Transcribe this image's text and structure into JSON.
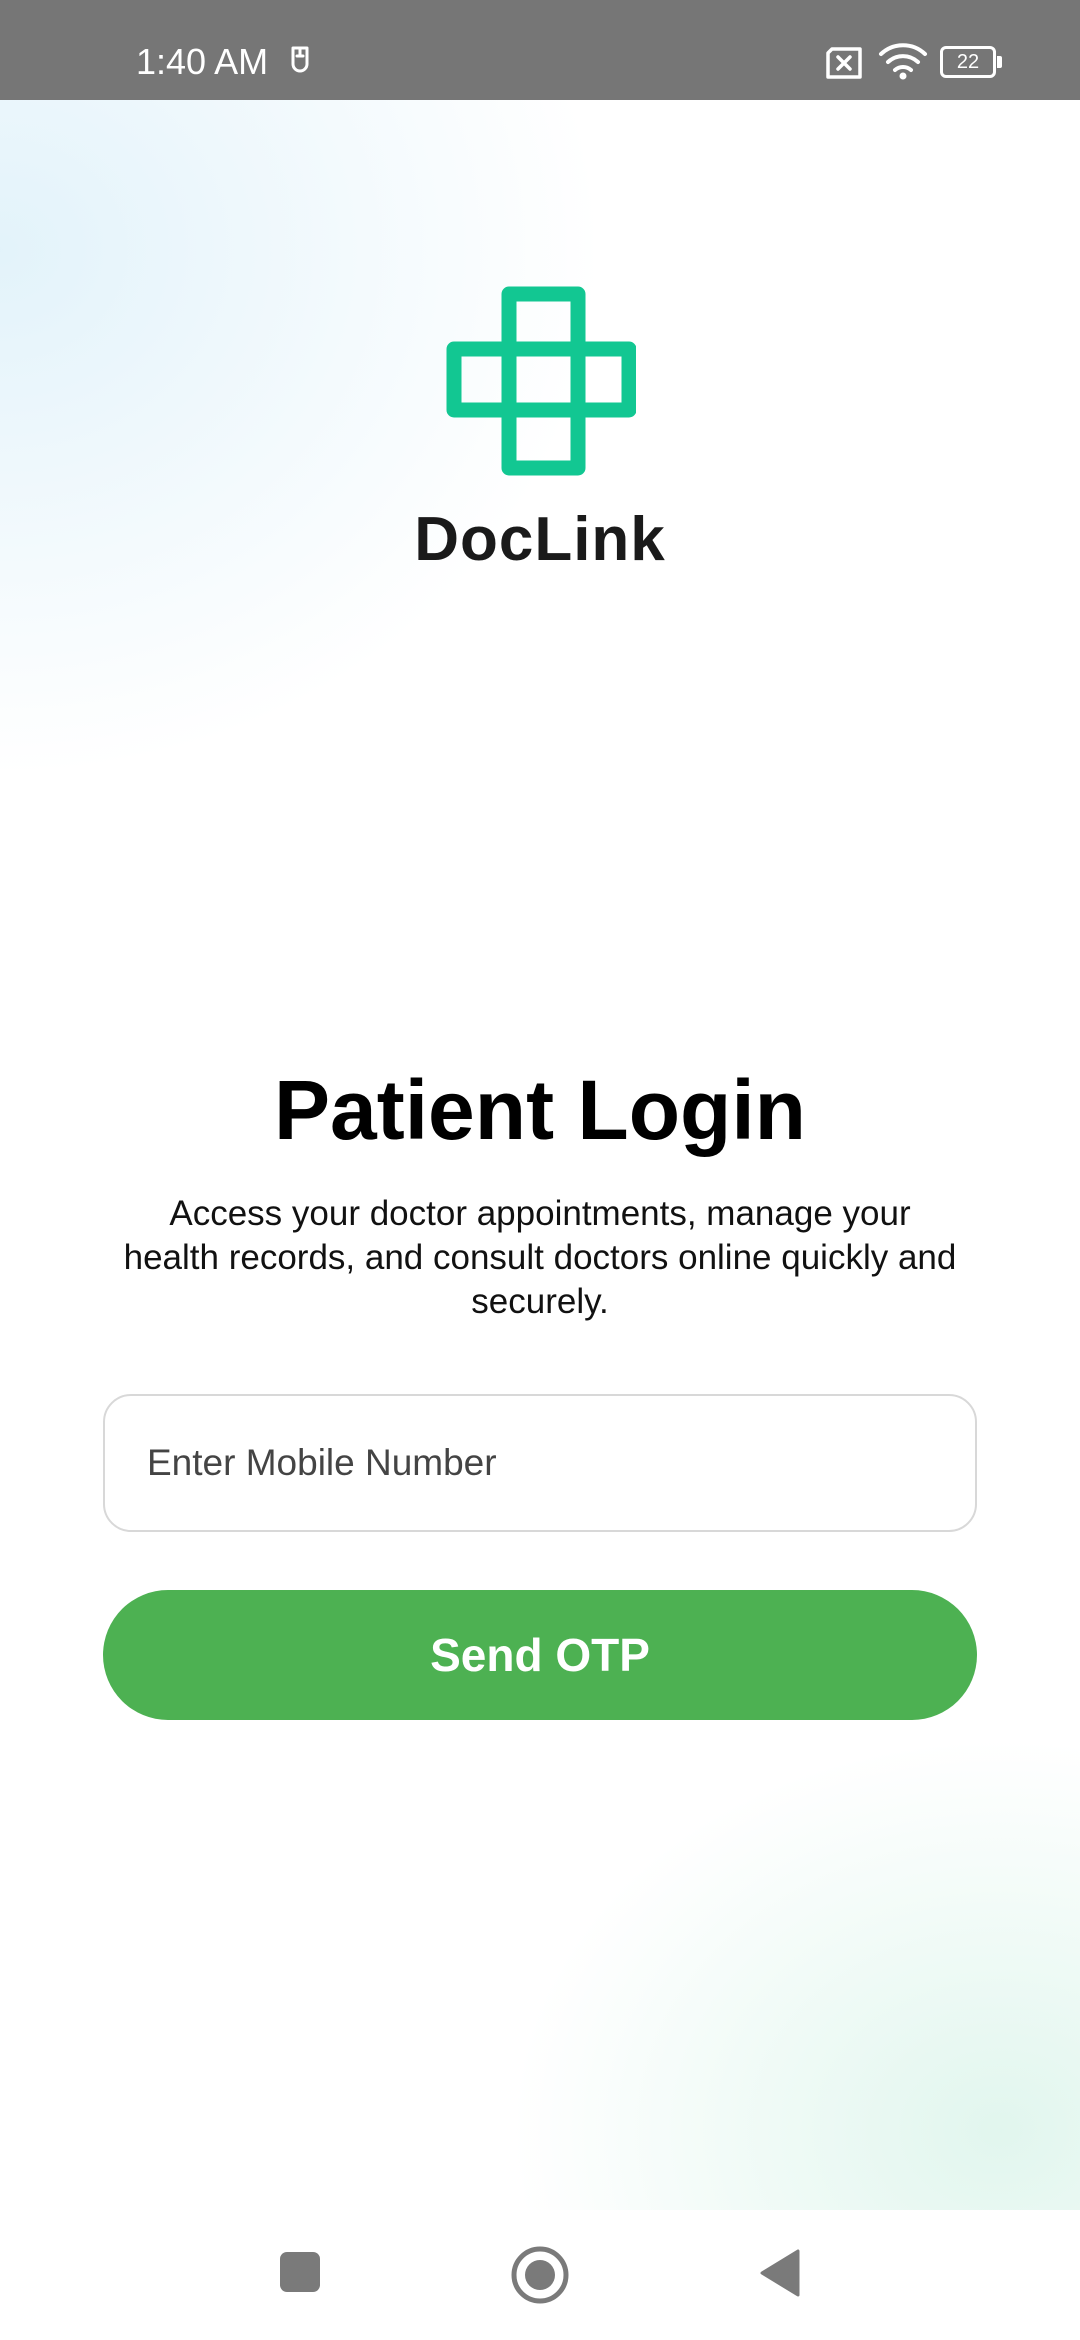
{
  "status_bar": {
    "time": "1:40 AM",
    "battery_level": "22",
    "icons": [
      "alarm-icon",
      "sim-off-icon",
      "wifi-icon",
      "battery-icon"
    ]
  },
  "brand": {
    "name": "DocLink",
    "logo_icon": "medical-cross-logo",
    "logo_color": "#12c792"
  },
  "login": {
    "title": "Patient Login",
    "subtitle": "Access your doctor appointments, manage your health records, and consult doctors online quickly and securely.",
    "mobile_input": {
      "placeholder": "Enter Mobile Number",
      "value": ""
    },
    "submit_label": "Send OTP",
    "accent_color": "#4db152"
  },
  "nav_bar": {
    "buttons": [
      "recents-icon",
      "home-icon",
      "back-icon"
    ]
  }
}
